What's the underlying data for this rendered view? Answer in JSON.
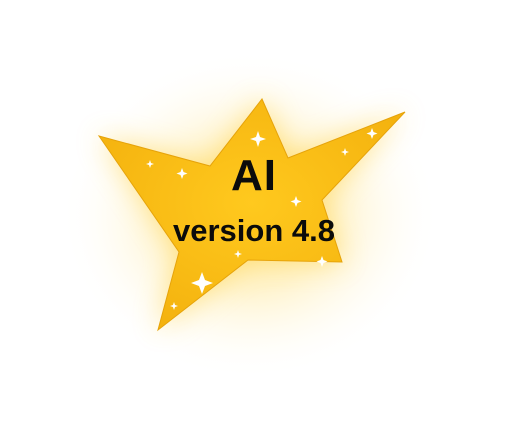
{
  "logo": {
    "title": "AI",
    "subtitle": "version 4.8",
    "star_color": "#f7bb11",
    "star_outline": "#e6a30a",
    "glow_color": "#ffcc22",
    "sparkle_color": "#ffffff",
    "icon": "star-icon"
  }
}
